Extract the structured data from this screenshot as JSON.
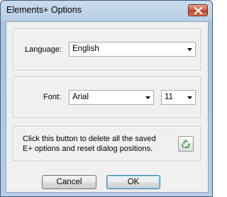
{
  "window": {
    "title": "Elements+ Options"
  },
  "language": {
    "label": "Language:",
    "selected": "English"
  },
  "font": {
    "label": "Font:",
    "family_selected": "Arial",
    "size_selected": "11"
  },
  "reset": {
    "description": "Click this button to delete all the saved E+ options and reset dialog positions."
  },
  "buttons": {
    "cancel": "Cancel",
    "ok": "OK"
  },
  "icons": {
    "close": "close-icon",
    "dropdown": "chevron-down-icon",
    "reset": "recycle-icon"
  },
  "colors": {
    "close_button": "#c94a32",
    "recycle_green": "#3a9a3a"
  }
}
